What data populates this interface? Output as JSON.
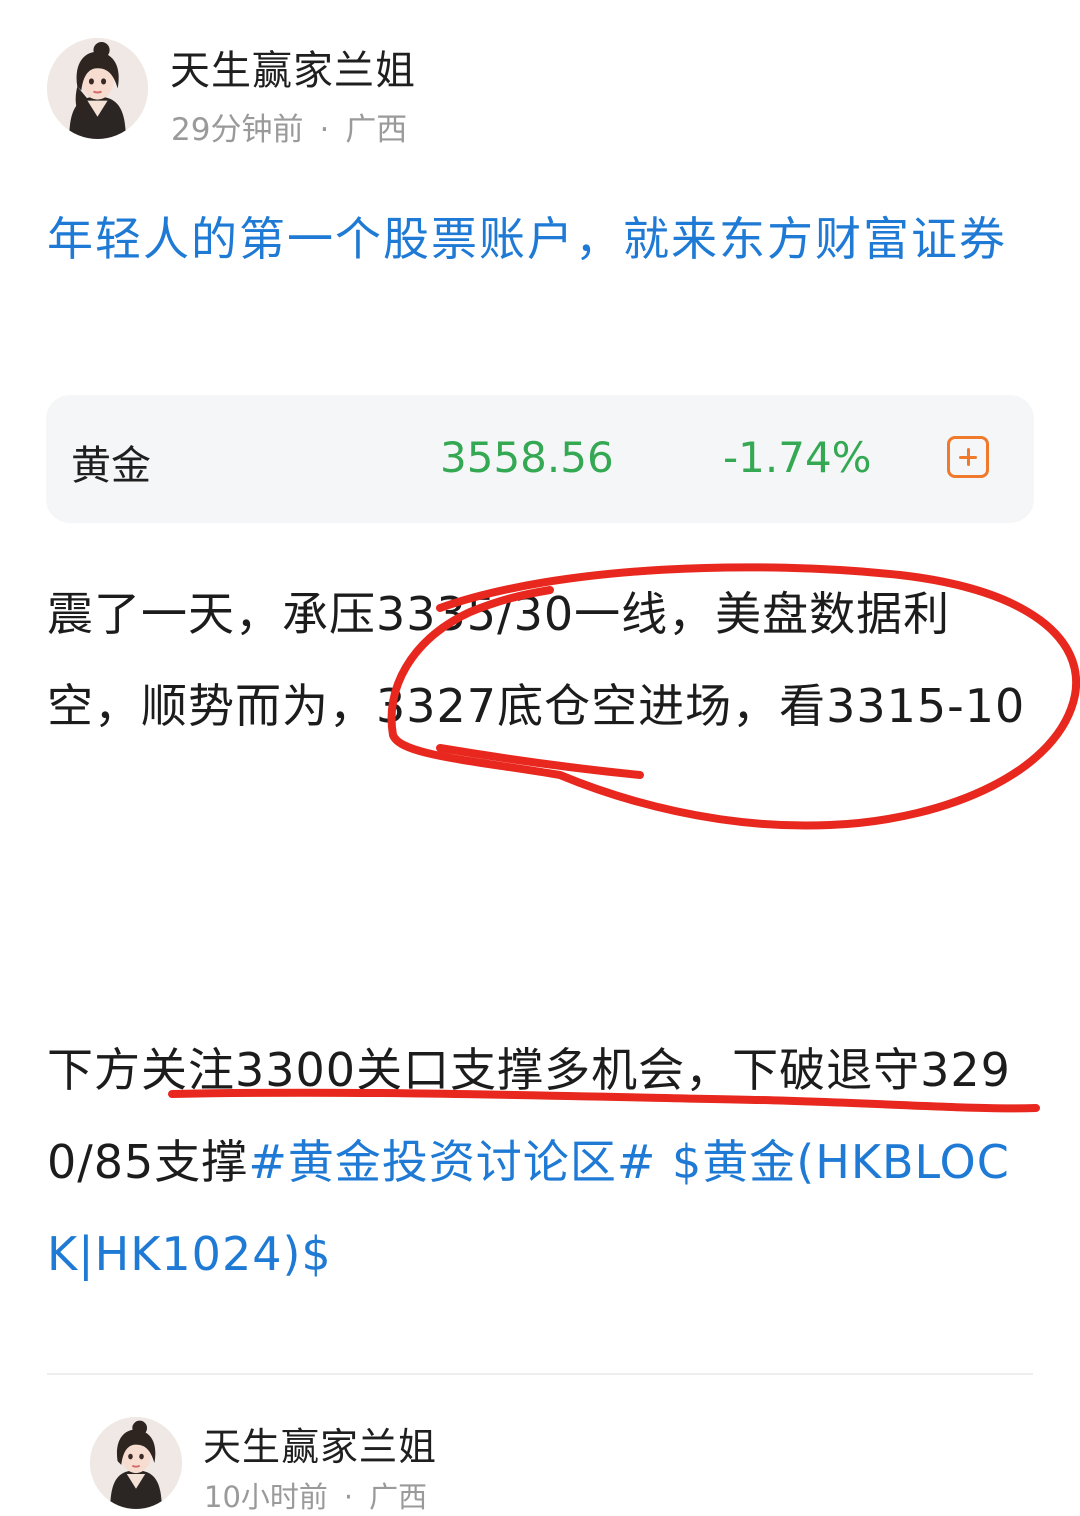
{
  "post": {
    "author": "天生赢家兰姐",
    "time": "29分钟前",
    "location": "广西",
    "title": "年轻人的第一个股票账户，就来东方财富证券",
    "quote": {
      "name": "黄金",
      "price": "3558.56",
      "change": "-1.74%",
      "add_icon": "plus-square-icon",
      "color": "#34a853"
    },
    "paragraph1": "震了一天，承压3335/30一线，美盘数据利空，顺势而为，3327底仓空进场，看3315-10",
    "paragraph2_text": "下方关注3300关口支撑多机会，下破退守3290/85支撑",
    "topic_tag": "#黄金投资讨论区#",
    "stock_tag": "$黄金(HKBLOCK|HK1024)$"
  },
  "next_post": {
    "author": "天生赢家兰姐",
    "time": "10小时前",
    "location": "广西"
  },
  "colors": {
    "link": "#1e7ad4",
    "annotation": "#e8281e"
  }
}
